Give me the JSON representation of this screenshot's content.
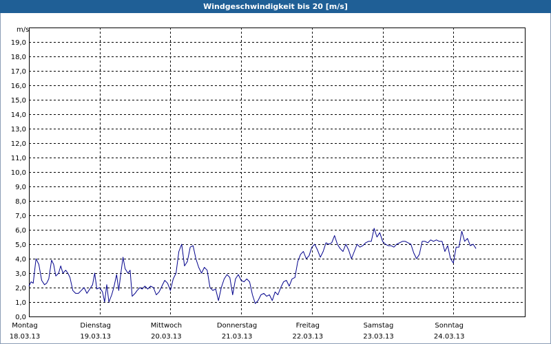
{
  "window": {
    "title": "Windgeschwindigkeit bis 20 [m/s]"
  },
  "colors": {
    "titlebar": "#1f5f96",
    "series": "#00008b",
    "grid": "#000000"
  },
  "chart_data": {
    "type": "line",
    "title": "Windgeschwindigkeit bis 20 [m/s]",
    "ylabel": "m/s",
    "ylim": [
      0,
      20
    ],
    "yticks": [
      "0,0",
      "1,0",
      "2,0",
      "3,0",
      "4,0",
      "5,0",
      "6,0",
      "7,0",
      "8,0",
      "9,0",
      "10,0",
      "11,0",
      "12,0",
      "13,0",
      "14,0",
      "15,0",
      "16,0",
      "17,0",
      "18,0",
      "19,0"
    ],
    "xlim": [
      0,
      7
    ],
    "day_labels": [
      {
        "day": "Montag",
        "date": "18.03.13"
      },
      {
        "day": "Dienstag",
        "date": "19.03.13"
      },
      {
        "day": "Mittwoch",
        "date": "20.03.13"
      },
      {
        "day": "Donnerstag",
        "date": "21.03.13"
      },
      {
        "day": "Freitag",
        "date": "22.03.13"
      },
      {
        "day": "Samstag",
        "date": "23.03.13"
      },
      {
        "day": "Sonntag",
        "date": "24.03.13"
      }
    ],
    "grid": true,
    "legend": "none",
    "series": [
      {
        "values": [
          [
            0.0,
            2.1
          ],
          [
            0.03,
            2.4
          ],
          [
            0.06,
            2.3
          ],
          [
            0.1,
            4.0
          ],
          [
            0.14,
            3.6
          ],
          [
            0.18,
            2.5
          ],
          [
            0.22,
            2.2
          ],
          [
            0.25,
            2.3
          ],
          [
            0.28,
            2.6
          ],
          [
            0.32,
            3.9
          ],
          [
            0.35,
            3.6
          ],
          [
            0.38,
            2.8
          ],
          [
            0.42,
            3.0
          ],
          [
            0.45,
            3.5
          ],
          [
            0.48,
            3.0
          ],
          [
            0.52,
            3.2
          ],
          [
            0.55,
            3.0
          ],
          [
            0.58,
            2.7
          ],
          [
            0.62,
            1.8
          ],
          [
            0.66,
            1.6
          ],
          [
            0.7,
            1.6
          ],
          [
            0.74,
            1.8
          ],
          [
            0.78,
            2.0
          ],
          [
            0.82,
            1.6
          ],
          [
            0.86,
            1.9
          ],
          [
            0.9,
            2.2
          ],
          [
            0.93,
            3.0
          ],
          [
            0.96,
            1.9
          ],
          [
            1.0,
            2.0
          ],
          [
            1.04,
            1.7
          ],
          [
            1.07,
            1.0
          ],
          [
            1.1,
            2.2
          ],
          [
            1.13,
            1.0
          ],
          [
            1.17,
            1.5
          ],
          [
            1.2,
            2.0
          ],
          [
            1.24,
            2.9
          ],
          [
            1.27,
            1.8
          ],
          [
            1.3,
            3.0
          ],
          [
            1.33,
            4.1
          ],
          [
            1.36,
            3.3
          ],
          [
            1.4,
            3.0
          ],
          [
            1.43,
            3.2
          ],
          [
            1.46,
            1.4
          ],
          [
            1.5,
            1.6
          ],
          [
            1.53,
            1.8
          ],
          [
            1.57,
            2.0
          ],
          [
            1.6,
            1.9
          ],
          [
            1.64,
            2.1
          ],
          [
            1.68,
            1.9
          ],
          [
            1.72,
            2.1
          ],
          [
            1.76,
            2.0
          ],
          [
            1.8,
            1.5
          ],
          [
            1.84,
            1.7
          ],
          [
            1.88,
            2.1
          ],
          [
            1.92,
            2.5
          ],
          [
            1.96,
            2.3
          ],
          [
            2.0,
            1.8
          ],
          [
            2.04,
            2.6
          ],
          [
            2.08,
            3.0
          ],
          [
            2.12,
            4.5
          ],
          [
            2.16,
            5.0
          ],
          [
            2.2,
            3.5
          ],
          [
            2.24,
            3.8
          ],
          [
            2.28,
            4.8
          ],
          [
            2.32,
            4.9
          ],
          [
            2.36,
            4.0
          ],
          [
            2.4,
            3.4
          ],
          [
            2.44,
            3.0
          ],
          [
            2.48,
            3.4
          ],
          [
            2.52,
            3.2
          ],
          [
            2.56,
            2.0
          ],
          [
            2.6,
            1.8
          ],
          [
            2.64,
            1.9
          ],
          [
            2.68,
            1.1
          ],
          [
            2.72,
            2.0
          ],
          [
            2.76,
            2.6
          ],
          [
            2.8,
            2.9
          ],
          [
            2.84,
            2.7
          ],
          [
            2.88,
            1.5
          ],
          [
            2.92,
            2.6
          ],
          [
            2.96,
            2.9
          ],
          [
            3.0,
            2.5
          ],
          [
            3.04,
            2.4
          ],
          [
            3.08,
            2.6
          ],
          [
            3.12,
            2.4
          ],
          [
            3.16,
            1.5
          ],
          [
            3.2,
            0.9
          ],
          [
            3.24,
            1.1
          ],
          [
            3.28,
            1.5
          ],
          [
            3.32,
            1.6
          ],
          [
            3.36,
            1.4
          ],
          [
            3.4,
            1.5
          ],
          [
            3.44,
            1.1
          ],
          [
            3.48,
            1.7
          ],
          [
            3.52,
            1.5
          ],
          [
            3.56,
            2.0
          ],
          [
            3.6,
            2.4
          ],
          [
            3.64,
            2.5
          ],
          [
            3.68,
            2.1
          ],
          [
            3.72,
            2.6
          ],
          [
            3.76,
            2.7
          ],
          [
            3.8,
            3.8
          ],
          [
            3.84,
            4.3
          ],
          [
            3.88,
            4.5
          ],
          [
            3.92,
            4.0
          ],
          [
            3.96,
            4.2
          ],
          [
            4.0,
            4.8
          ],
          [
            4.04,
            5.0
          ],
          [
            4.08,
            4.6
          ],
          [
            4.12,
            4.1
          ],
          [
            4.16,
            4.5
          ],
          [
            4.2,
            5.1
          ],
          [
            4.24,
            5.0
          ],
          [
            4.28,
            5.1
          ],
          [
            4.32,
            5.6
          ],
          [
            4.36,
            5.0
          ],
          [
            4.4,
            4.7
          ],
          [
            4.44,
            4.5
          ],
          [
            4.48,
            5.0
          ],
          [
            4.52,
            4.6
          ],
          [
            4.56,
            4.0
          ],
          [
            4.6,
            4.5
          ],
          [
            4.64,
            5.0
          ],
          [
            4.68,
            4.8
          ],
          [
            4.72,
            4.9
          ],
          [
            4.76,
            5.1
          ],
          [
            4.8,
            5.2
          ],
          [
            4.84,
            5.2
          ],
          [
            4.88,
            6.1
          ],
          [
            4.92,
            5.5
          ],
          [
            4.96,
            5.8
          ],
          [
            5.0,
            5.2
          ],
          [
            5.04,
            5.0
          ],
          [
            5.08,
            4.9
          ],
          [
            5.12,
            4.9
          ],
          [
            5.16,
            4.8
          ],
          [
            5.2,
            5.0
          ],
          [
            5.24,
            5.1
          ],
          [
            5.28,
            5.2
          ],
          [
            5.32,
            5.2
          ],
          [
            5.36,
            5.1
          ],
          [
            5.4,
            5.0
          ],
          [
            5.44,
            4.4
          ],
          [
            5.48,
            4.0
          ],
          [
            5.52,
            4.3
          ],
          [
            5.56,
            5.2
          ],
          [
            5.6,
            5.2
          ],
          [
            5.64,
            5.1
          ],
          [
            5.68,
            5.3
          ],
          [
            5.72,
            5.2
          ],
          [
            5.76,
            5.3
          ],
          [
            5.8,
            5.2
          ],
          [
            5.84,
            5.2
          ],
          [
            5.88,
            4.5
          ],
          [
            5.92,
            4.9
          ],
          [
            5.96,
            4.0
          ],
          [
            6.0,
            3.7
          ],
          [
            6.04,
            4.8
          ],
          [
            6.08,
            4.8
          ],
          [
            6.12,
            5.9
          ],
          [
            6.16,
            5.2
          ],
          [
            6.2,
            5.4
          ],
          [
            6.24,
            4.9
          ],
          [
            6.28,
            5.0
          ],
          [
            6.32,
            4.7
          ]
        ]
      }
    ]
  }
}
